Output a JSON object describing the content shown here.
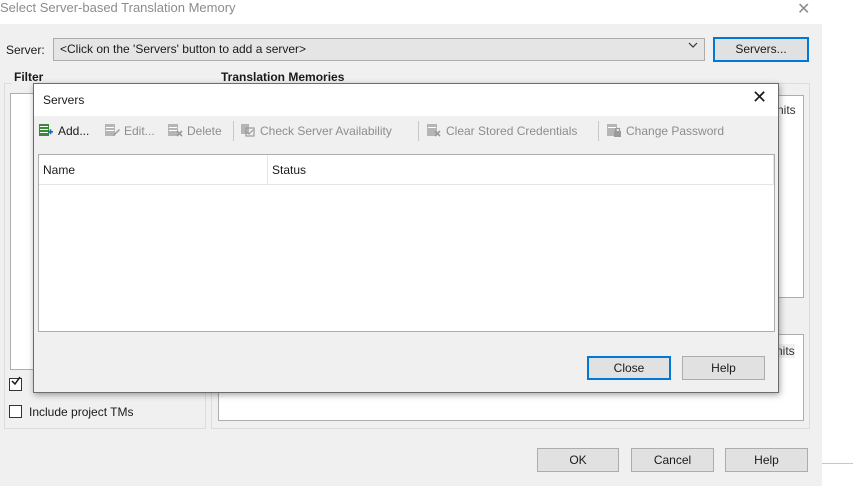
{
  "window": {
    "title": "Select Server-based Translation Memory",
    "close_glyph": "✕"
  },
  "server": {
    "label": "Server:",
    "value": "<Click on the 'Servers' button to add a server>",
    "servers_button": "Servers..."
  },
  "filter": {
    "label": "Filter",
    "include_project_tms": "Include project TMs",
    "checkbox1_checked": true,
    "checkbox2_checked": false
  },
  "translation_memories": {
    "label": "Translation Memories",
    "peek_text1": "nits",
    "peek_text2": "nits"
  },
  "buttons": {
    "ok": "OK",
    "cancel": "Cancel",
    "help": "Help"
  },
  "servers_dialog": {
    "title": "Servers",
    "close_glyph": "✕",
    "toolbar": {
      "add": "Add...",
      "edit": "Edit...",
      "delete": "Delete",
      "check_server_availability": "Check Server Availability",
      "clear_stored_credentials": "Clear Stored Credentials",
      "change_password": "Change Password"
    },
    "columns": [
      "Name",
      "Status"
    ],
    "close_button": "Close",
    "help_button": "Help"
  },
  "colors": {
    "focus_border": "#0078d7",
    "dialog_bg": "#f0f0f0",
    "disabled_text": "#8d8d8d"
  }
}
